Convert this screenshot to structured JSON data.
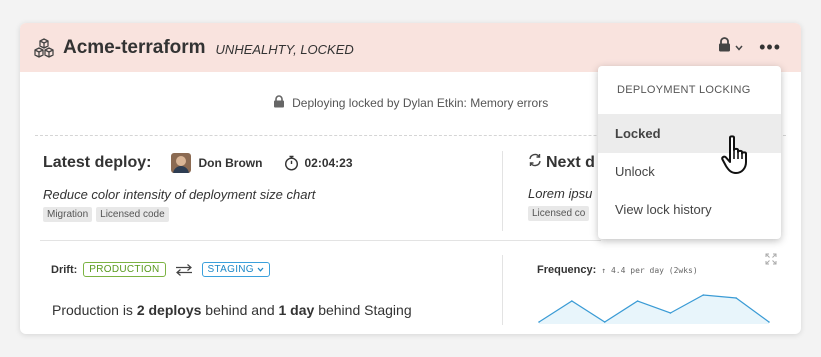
{
  "app": {
    "icon": "cubes-icon",
    "title": "Acme-terraform",
    "status": "UNHEALHTY, LOCKED"
  },
  "header_actions": {
    "lock_icon": "lock-icon",
    "dropdown_icon": "chevron-down-icon",
    "more_label": "•••"
  },
  "lock_notice": {
    "icon": "lock-icon",
    "text": "Deploying locked by Dylan Etkin: Memory errors"
  },
  "latest_deploy": {
    "title": "Latest deploy:",
    "author": "Don Brown",
    "duration": "02:04:23",
    "message": "Reduce color intensity of deployment size chart",
    "tags": [
      "Migration",
      "Licensed code"
    ]
  },
  "next_deploy": {
    "title": "Next d",
    "message": "Lorem ipsu",
    "tags": [
      "Licensed co"
    ]
  },
  "drift": {
    "label": "Drift:",
    "from_env": "PRODUCTION",
    "to_env": "STAGING",
    "summary_prefix": "Production is ",
    "deploys_behind": "2 deploys",
    "summary_middle": " behind and ",
    "days_behind": "1 day",
    "summary_suffix": " behind Staging"
  },
  "frequency": {
    "label": "Frequency:",
    "value": "↑ 4.4 per day (2wks)"
  },
  "chart_data": {
    "type": "area",
    "values": [
      0,
      7,
      0,
      7,
      3,
      9,
      8,
      0
    ],
    "ylim": [
      0,
      10
    ]
  },
  "lock_menu": {
    "heading": "DEPLOYMENT LOCKING",
    "items": [
      "Locked",
      "Unlock",
      "View lock history"
    ],
    "selected_index": 0
  },
  "colors": {
    "header_bg": "#f9e3de",
    "production": "#7cb342",
    "staging": "#3aa0dc",
    "chart_line": "#3a9bd5",
    "chart_fill": "#e8f5fb"
  }
}
